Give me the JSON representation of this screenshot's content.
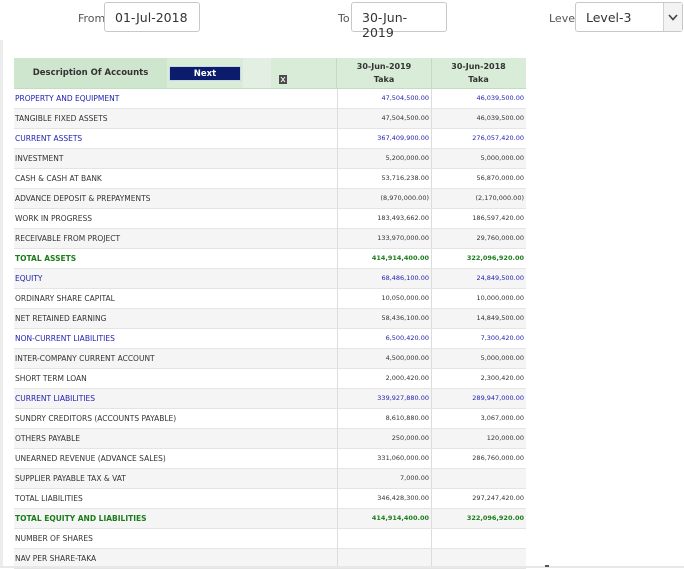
{
  "filters": {
    "from_label": "From",
    "from_value": "01-Jul-2018",
    "to_label": "To",
    "to_value": "30-Jun-2019",
    "level_label": "Level",
    "level_value": "Level-3"
  },
  "table": {
    "desc_header": "Description Of Accounts",
    "next_label": "Next",
    "columns": [
      {
        "date": "30-Jun-2019",
        "unit": "Taka"
      },
      {
        "date": "30-Jun-2018",
        "unit": "Taka"
      }
    ],
    "rows": [
      {
        "label": "PROPERTY AND EQUIPMENT",
        "v1": "47,504,500.00",
        "v2": "46,039,500.00",
        "kind": "head"
      },
      {
        "label": "TANGIBLE FIXED ASSETS",
        "v1": "47,504,500.00",
        "v2": "46,039,500.00",
        "kind": "item"
      },
      {
        "label": "CURRENT ASSETS",
        "v1": "367,409,900.00",
        "v2": "276,057,420.00",
        "kind": "head"
      },
      {
        "label": "INVESTMENT",
        "v1": "5,200,000.00",
        "v2": "5,000,000.00",
        "kind": "item"
      },
      {
        "label": "CASH & CASH AT BANK",
        "v1": "53,716,238.00",
        "v2": "56,870,000.00",
        "kind": "item"
      },
      {
        "label": "ADVANCE DEPOSIT & PREPAYMENTS",
        "v1": "(8,970,000.00)",
        "v2": "(2,170,000.00)",
        "kind": "item"
      },
      {
        "label": "WORK IN PROGRESS",
        "v1": "183,493,662.00",
        "v2": "186,597,420.00",
        "kind": "item"
      },
      {
        "label": "RECEIVABLE FROM PROJECT",
        "v1": "133,970,000.00",
        "v2": "29,760,000.00",
        "kind": "item"
      },
      {
        "label": "TOTAL ASSETS",
        "v1": "414,914,400.00",
        "v2": "322,096,920.00",
        "kind": "total"
      },
      {
        "label": "EQUITY",
        "v1": "68,486,100.00",
        "v2": "24,849,500.00",
        "kind": "head"
      },
      {
        "label": "ORDINARY SHARE CAPITAL",
        "v1": "10,050,000.00",
        "v2": "10,000,000.00",
        "kind": "item"
      },
      {
        "label": "NET RETAINED EARNING",
        "v1": "58,436,100.00",
        "v2": "14,849,500.00",
        "kind": "item"
      },
      {
        "label": "NON-CURRENT LIABILITIES",
        "v1": "6,500,420.00",
        "v2": "7,300,420.00",
        "kind": "head"
      },
      {
        "label": "INTER-COMPANY CURRENT ACCOUNT",
        "v1": "4,500,000.00",
        "v2": "5,000,000.00",
        "kind": "item"
      },
      {
        "label": "SHORT TERM LOAN",
        "v1": "2,000,420.00",
        "v2": "2,300,420.00",
        "kind": "item"
      },
      {
        "label": "CURRENT LIABILITIES",
        "v1": "339,927,880.00",
        "v2": "289,947,000.00",
        "kind": "head"
      },
      {
        "label": "SUNDRY CREDITORS (ACCOUNTS PAYABLE)",
        "v1": "8,610,880.00",
        "v2": "3,067,000.00",
        "kind": "item"
      },
      {
        "label": "OTHERS PAYABLE",
        "v1": "250,000.00",
        "v2": "120,000.00",
        "kind": "item"
      },
      {
        "label": "UNEARNED REVENUE (ADVANCE SALES)",
        "v1": "331,060,000.00",
        "v2": "286,760,000.00",
        "kind": "item"
      },
      {
        "label": "SUPPLIER PAYABLE TAX & VAT",
        "v1": "7,000.00",
        "v2": "",
        "kind": "item"
      },
      {
        "label": "TOTAL LIABILITIES",
        "v1": "346,428,300.00",
        "v2": "297,247,420.00",
        "kind": "item"
      },
      {
        "label": "TOTAL EQUITY AND LIABILITIES",
        "v1": "414,914,400.00",
        "v2": "322,096,920.00",
        "kind": "total"
      },
      {
        "label": "NUMBER OF SHARES",
        "v1": "",
        "v2": "",
        "kind": "item"
      },
      {
        "label": "NAV PER SHARE-TAKA",
        "v1": "",
        "v2": "",
        "kind": "item"
      }
    ]
  },
  "colors": {
    "header_bg": "#d8ecd7",
    "next_button": "#0a1c6b",
    "group_text": "#2222b0",
    "total_text": "#1b7c1b"
  },
  "icons": {
    "export": "excel-export-icon",
    "dropdown": "chevron-down-icon"
  }
}
